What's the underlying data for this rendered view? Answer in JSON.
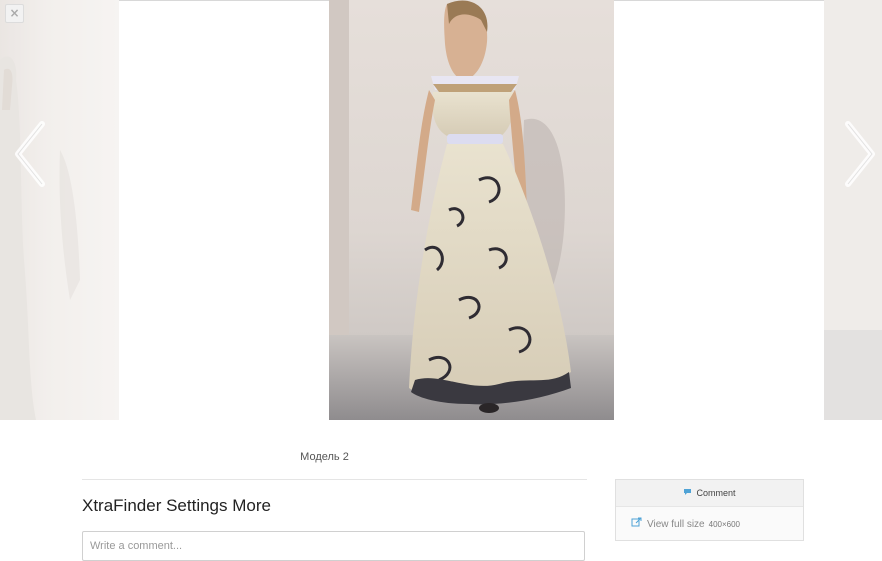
{
  "viewer": {
    "close_label": "×",
    "caption": "Модель 2"
  },
  "album": {
    "title": "XtraFinder Settings More"
  },
  "comment": {
    "placeholder": "Write a comment..."
  },
  "panel": {
    "comment_label": "Comment",
    "view_full_size_label": "View full size",
    "dimensions": "400×600"
  },
  "colors": {
    "accent": "#4fa3d6",
    "arrow": "#ffffff"
  },
  "icons": {
    "close": "close-icon",
    "prev": "chevron-left-icon",
    "next": "chevron-right-icon",
    "comment": "speech-bubble-icon",
    "full_size": "external-link-icon"
  }
}
